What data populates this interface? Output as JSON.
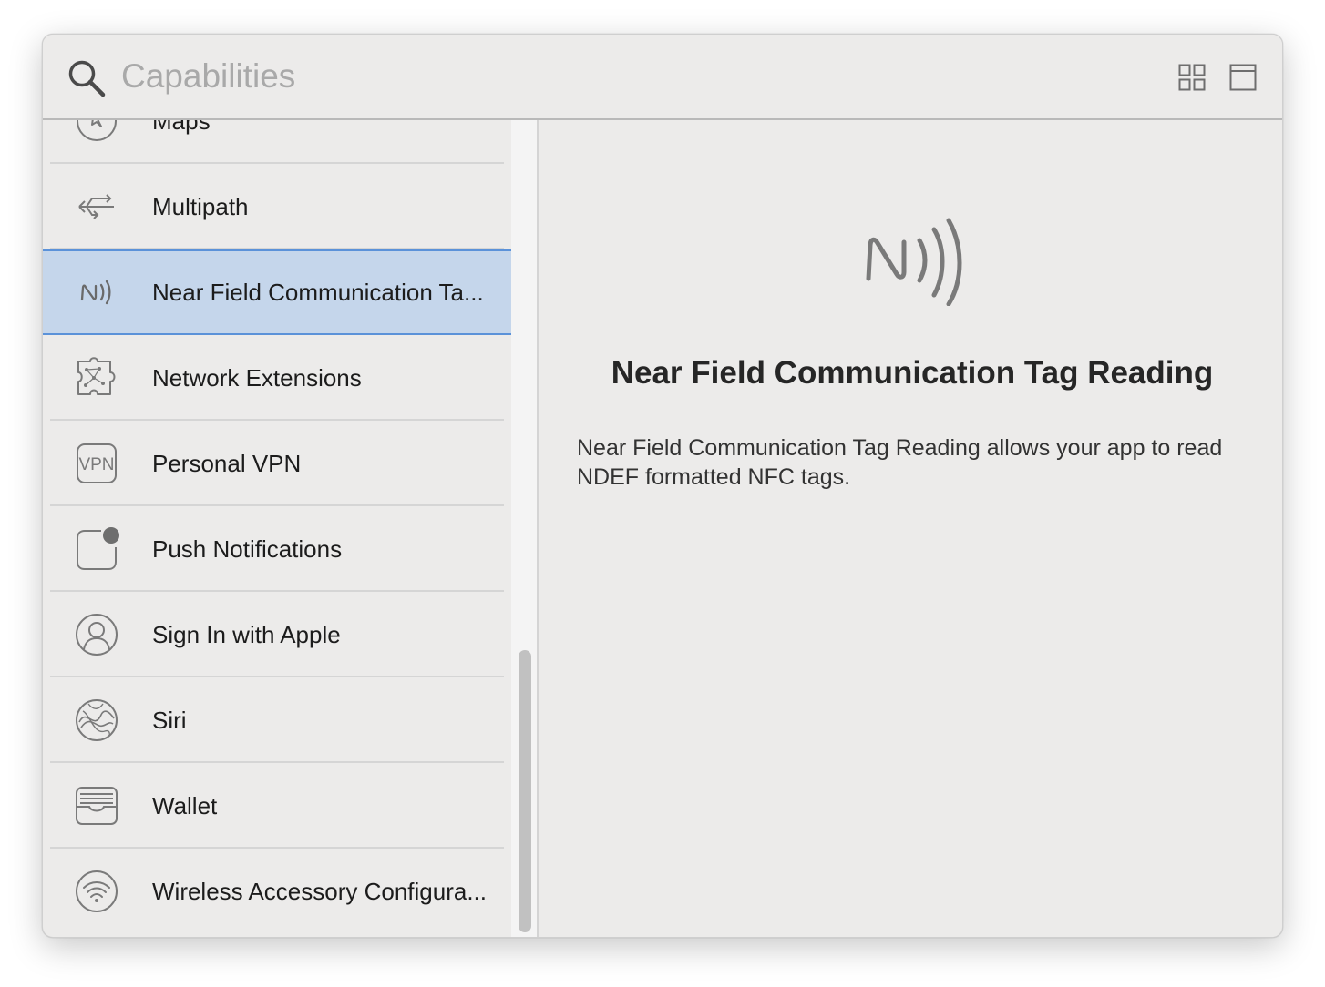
{
  "search": {
    "placeholder": "Capabilities",
    "value": ""
  },
  "toolbar": {
    "grid_view_icon": "grid-icon",
    "detail_view_icon": "panel-icon"
  },
  "sidebar": {
    "items": [
      {
        "label": "Maps",
        "icon": "compass-icon"
      },
      {
        "label": "Multipath",
        "icon": "multipath-arrows-icon"
      },
      {
        "label": "Near Field Communication Ta...",
        "icon": "nfc-icon",
        "selected": true
      },
      {
        "label": "Network Extensions",
        "icon": "puzzle-network-icon"
      },
      {
        "label": "Personal VPN",
        "icon": "vpn-icon"
      },
      {
        "label": "Push Notifications",
        "icon": "notification-badge-icon"
      },
      {
        "label": "Sign In with Apple",
        "icon": "person-icon"
      },
      {
        "label": "Siri",
        "icon": "siri-icon"
      },
      {
        "label": "Wallet",
        "icon": "wallet-icon"
      },
      {
        "label": "Wireless Accessory Configura...",
        "icon": "wifi-icon"
      }
    ]
  },
  "detail": {
    "icon": "nfc-icon",
    "title": "Near Field Communication Tag Reading",
    "description": "Near Field Communication Tag Reading allows your app to read NDEF formatted NFC tags."
  },
  "colors": {
    "selection_fill": "#c5d6eb",
    "selection_border": "#5b92d9",
    "window_bg": "#ecebea",
    "icon_gray": "#7a7a7a"
  }
}
